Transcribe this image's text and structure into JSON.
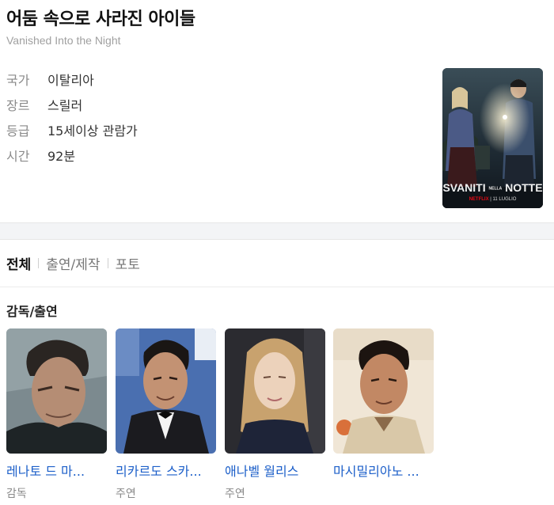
{
  "header": {
    "title": "어둠 속으로 사라진 아이들",
    "subtitle": "Vanished Into the Night"
  },
  "info": [
    {
      "label": "국가",
      "value": "이탈리아"
    },
    {
      "label": "장르",
      "value": "스릴러"
    },
    {
      "label": "등급",
      "value": "15세이상 관람가"
    },
    {
      "label": "시간",
      "value": "92분"
    }
  ],
  "poster": {
    "title_left": "SVANITI",
    "title_mid": "NELLA",
    "title_right": "NOTTE",
    "brand": "NETFLIX",
    "date": "11 LUGLIO"
  },
  "tabs": {
    "all": "전체",
    "cast_crew": "출연/제작",
    "photo": "포토"
  },
  "section": {
    "title": "감독/출연"
  },
  "cast": [
    {
      "name": "레나토 드 마...",
      "role": "감독"
    },
    {
      "name": "리카르도 스카...",
      "role": "주연"
    },
    {
      "name": "애나벨 월리스",
      "role": "주연"
    },
    {
      "name": "마시밀리아노 ...",
      "role": ""
    }
  ],
  "colors": {
    "link": "#1c5fc9",
    "muted": "#8a8a8a",
    "band": "#f3f4f6"
  }
}
